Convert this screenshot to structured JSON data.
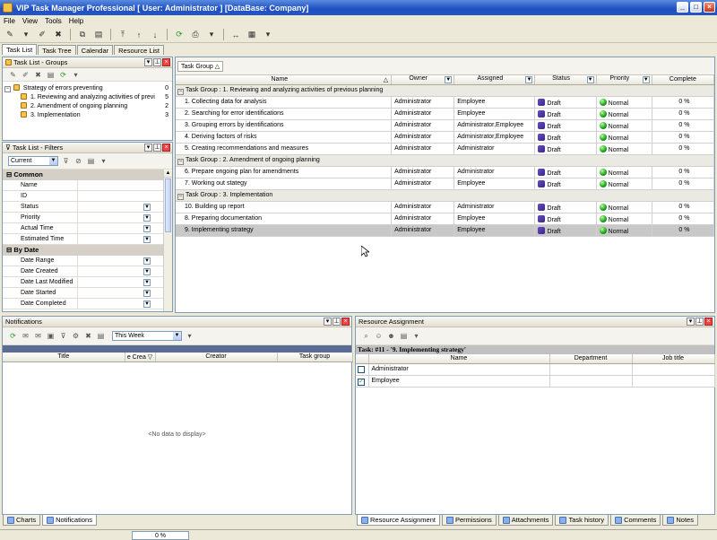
{
  "window": {
    "title": "VIP Task Manager Professional [ User: Administrator ] [DataBase: Company]"
  },
  "menu": {
    "items": [
      "File",
      "View",
      "Tools",
      "Help"
    ]
  },
  "main_tabs": [
    "Task List",
    "Task Tree",
    "Calendar",
    "Resource List"
  ],
  "groups_panel": {
    "title": "Task List - Groups",
    "root": {
      "label": "Strategy of errors preventing",
      "count": "0"
    },
    "items": [
      {
        "label": "1. Reviewing and analyzing activities of previ",
        "count": "5"
      },
      {
        "label": "2. Amendment of ongoing planning",
        "count": "2"
      },
      {
        "label": "3. Implementation",
        "count": "3"
      }
    ]
  },
  "filters_panel": {
    "title": "Task List - Filters",
    "filter_select": "Current",
    "categories": [
      {
        "name": "Common",
        "fields": [
          {
            "label": "Name",
            "dropdown": false
          },
          {
            "label": "ID",
            "dropdown": false
          },
          {
            "label": "Status",
            "dropdown": true
          },
          {
            "label": "Priority",
            "dropdown": true
          },
          {
            "label": "Actual Time",
            "dropdown": true
          },
          {
            "label": "Estimated Time",
            "dropdown": true
          }
        ]
      },
      {
        "name": "By Date",
        "fields": [
          {
            "label": "Date Range",
            "dropdown": true
          },
          {
            "label": "Date Created",
            "dropdown": true
          },
          {
            "label": "Date Last Modified",
            "dropdown": true
          },
          {
            "label": "Date Started",
            "dropdown": true
          },
          {
            "label": "Date Completed",
            "dropdown": true
          }
        ]
      }
    ]
  },
  "task_grid": {
    "group_by_label": "Task Group",
    "columns": [
      "Name",
      "Owner",
      "Assigned",
      "Status",
      "Priority",
      "Complete"
    ],
    "groups": [
      {
        "label": "Task Group : 1. Reviewing and analyzing activities of previous planning",
        "rows": [
          {
            "name": "1. Collecting data for analysis",
            "owner": "Administrator",
            "assigned": "Employee",
            "status": "Draft",
            "priority": "Normal",
            "complete": "0 %"
          },
          {
            "name": "2. Searching for error identifications",
            "owner": "Administrator",
            "assigned": "Employee",
            "status": "Draft",
            "priority": "Normal",
            "complete": "0 %"
          },
          {
            "name": "3. Grouping errors by identifications",
            "owner": "Administrator",
            "assigned": "Administrator,Employee",
            "status": "Draft",
            "priority": "Normal",
            "complete": "0 %"
          },
          {
            "name": "4. Deriving factors of risks",
            "owner": "Administrator",
            "assigned": "Administrator,Employee",
            "status": "Draft",
            "priority": "Normal",
            "complete": "0 %"
          },
          {
            "name": "5. Creating recommendations and measures",
            "owner": "Administrator",
            "assigned": "Administrator",
            "status": "Draft",
            "priority": "Normal",
            "complete": "0 %"
          }
        ]
      },
      {
        "label": "Task Group : 2. Amendment of ongoing planning",
        "rows": [
          {
            "name": "6. Prepare ongoing plan for amendments",
            "owner": "Administrator",
            "assigned": "Administrator",
            "status": "Draft",
            "priority": "Normal",
            "complete": "0 %"
          },
          {
            "name": "7. Working out stategy",
            "owner": "Administrator",
            "assigned": "Employee",
            "status": "Draft",
            "priority": "Normal",
            "complete": "0 %"
          }
        ]
      },
      {
        "label": "Task Group : 3. Implementation",
        "rows": [
          {
            "name": "10. Building up report",
            "owner": "Administrator",
            "assigned": "Administrator",
            "status": "Draft",
            "priority": "Normal",
            "complete": "0 %"
          },
          {
            "name": "8. Preparing documentation",
            "owner": "Administrator",
            "assigned": "Employee",
            "status": "Draft",
            "priority": "Normal",
            "complete": "0 %"
          },
          {
            "name": "9. Implementing strategy",
            "owner": "Administrator",
            "assigned": "Employee",
            "status": "Draft",
            "priority": "Normal",
            "complete": "0 %",
            "selected": true
          }
        ]
      }
    ]
  },
  "notifications": {
    "title": "Notifications",
    "period": "This Week",
    "columns": [
      "Title",
      "e Crea",
      "Creator",
      "Task group"
    ],
    "empty_text": "<No data to display>",
    "bottom_tabs": [
      "Charts",
      "Notifications"
    ]
  },
  "resource_assignment": {
    "title": "Resource Assignment",
    "task_caption": "Task: #11 - '9. Implementing strategy'",
    "columns": [
      "Name",
      "Department",
      "Job title"
    ],
    "rows": [
      {
        "name": "Administrator",
        "checked": false
      },
      {
        "name": "Employee",
        "checked": true
      }
    ],
    "bottom_tabs": [
      "Resource Assignment",
      "Permissions",
      "Attachments",
      "Task history",
      "Comments",
      "Notes"
    ]
  },
  "statusbar": {
    "progress_text": "0 %",
    "progress": 0
  }
}
